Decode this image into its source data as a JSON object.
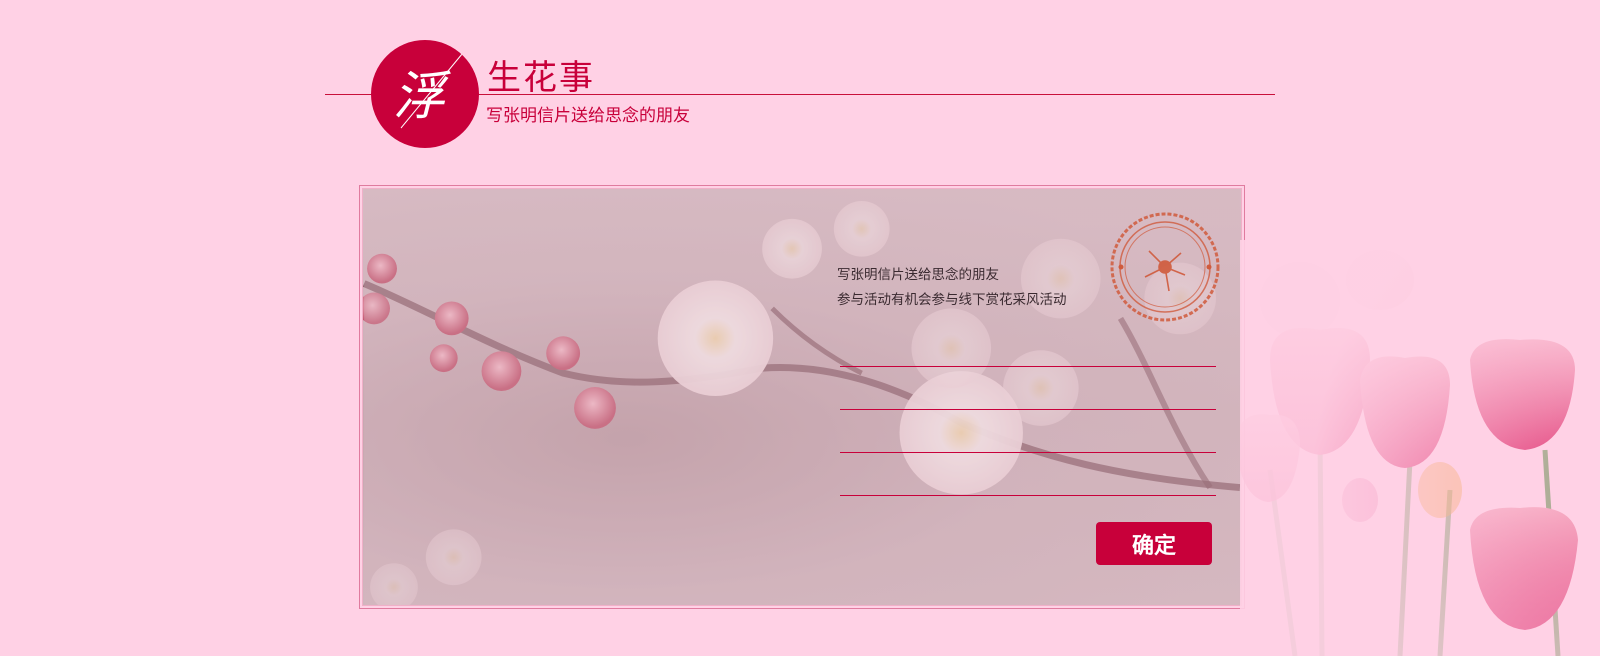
{
  "header": {
    "logo_char": "浮",
    "title": "生花事",
    "subtitle": "写张明信片送给思念的朋友"
  },
  "card": {
    "message_line1": "写张明信片送给思念的朋友",
    "message_line2": "参与活动有机会参与线下赏花采风活动",
    "inputs": [
      "",
      "",
      "",
      ""
    ],
    "confirm_label": "确定"
  },
  "colors": {
    "background": "#ffd1e5",
    "accent": "#c8003a"
  },
  "icons": {
    "stamp": "postmark-stamp-icon",
    "logo": "logo-circle-icon"
  }
}
